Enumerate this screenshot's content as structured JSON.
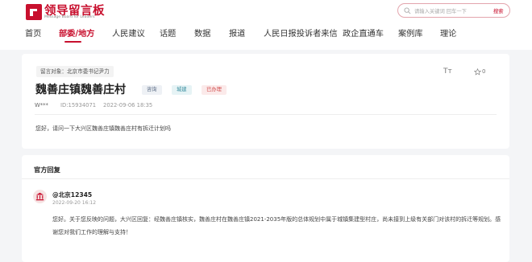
{
  "header": {
    "logo_title": "领导留言板",
    "logo_subtitle": "Message Board for Leaders",
    "search": {
      "placeholder": "请输入关键词 回车一下",
      "button_label": "搜索"
    }
  },
  "nav": {
    "items": [
      {
        "label": "首页"
      },
      {
        "label": "部委/地方",
        "active": true
      },
      {
        "label": "人民建议"
      },
      {
        "label": "话题"
      },
      {
        "label": "数据"
      },
      {
        "label": "报道"
      },
      {
        "label": "人民日报投诉者来信"
      },
      {
        "label": "政企直通车"
      },
      {
        "label": "案例库"
      },
      {
        "label": "理论"
      }
    ]
  },
  "message": {
    "target": "留言对象：北京市委书记尹力",
    "title": "魏善庄镇魏善庄村",
    "tags": [
      "咨询",
      "城建",
      "已办理"
    ],
    "user": "W***",
    "id": "ID:15934071",
    "date": "2022-09-06 18:35",
    "like_count": "0",
    "content": "您好，请问一下大兴区魏善庄镇魏善庄村有拆迁计划吗"
  },
  "reply": {
    "heading": "官方回复",
    "user": "@北京12345",
    "date": "2022-09-20 16:12",
    "content": "您好。关于您反映的问题，大兴区回复：经魏善庄镇核实，魏善庄村在魏善庄镇2021-2035年版的总体规划中属于城镇集建型村庄，尚未接到上级有关部门对该村的拆迁等规划。感谢您对我们工作的理解与支持！"
  },
  "colors": {
    "brand": "#c8102e",
    "page_bg": "#f4f5f7"
  },
  "icons": [
    "logo-icon",
    "search-icon",
    "font-size-icon",
    "star-icon",
    "avatar-icon"
  ]
}
